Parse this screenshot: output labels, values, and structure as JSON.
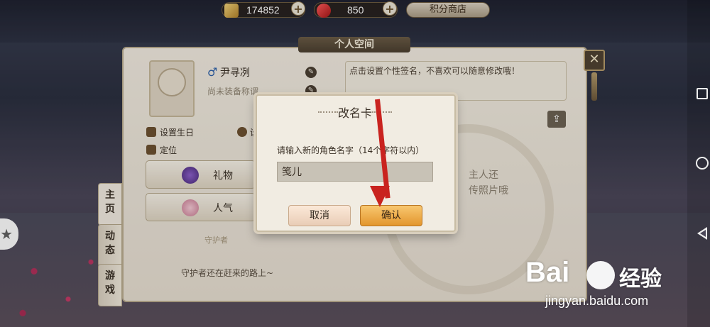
{
  "resources": {
    "gold": "174852",
    "gems": "850",
    "shop_label": "积分商店",
    "plus": "+"
  },
  "panel": {
    "title": "个人空间",
    "close": "✕",
    "player_name": "尹寻冽",
    "gender_symbol": "♂",
    "title_status": "尚未装备称谓",
    "signature_hint": "点击设置个性签名，不喜欢可以随意修改哦！",
    "set_birthday": "设置生日",
    "settings_partial": "设",
    "location": "定位",
    "gift_label": "礼物",
    "popularity_label": "人气",
    "guardian_title": "守护者",
    "guardian_text": "守护者还在赶来的路上~",
    "photo_hint_line1": "主人还",
    "photo_hint_line2": "传照片哦",
    "tabs": [
      {
        "label": "主\n页"
      },
      {
        "label": "动\n态"
      },
      {
        "label": "游\n戏"
      }
    ]
  },
  "dialog": {
    "title": "改名卡",
    "prompt": "请输入新的角色名字（14个字符以内）",
    "input_value": "笺儿",
    "cancel_label": "取消",
    "confirm_label": "确认"
  },
  "watermark": {
    "logo_text": "Bai",
    "suffix": "经验",
    "url": "jingyan.baidu.com"
  },
  "colors": {
    "accent_confirm": "#e3962d",
    "arrow": "#c9231f",
    "panel_bg": "#efe9de"
  }
}
